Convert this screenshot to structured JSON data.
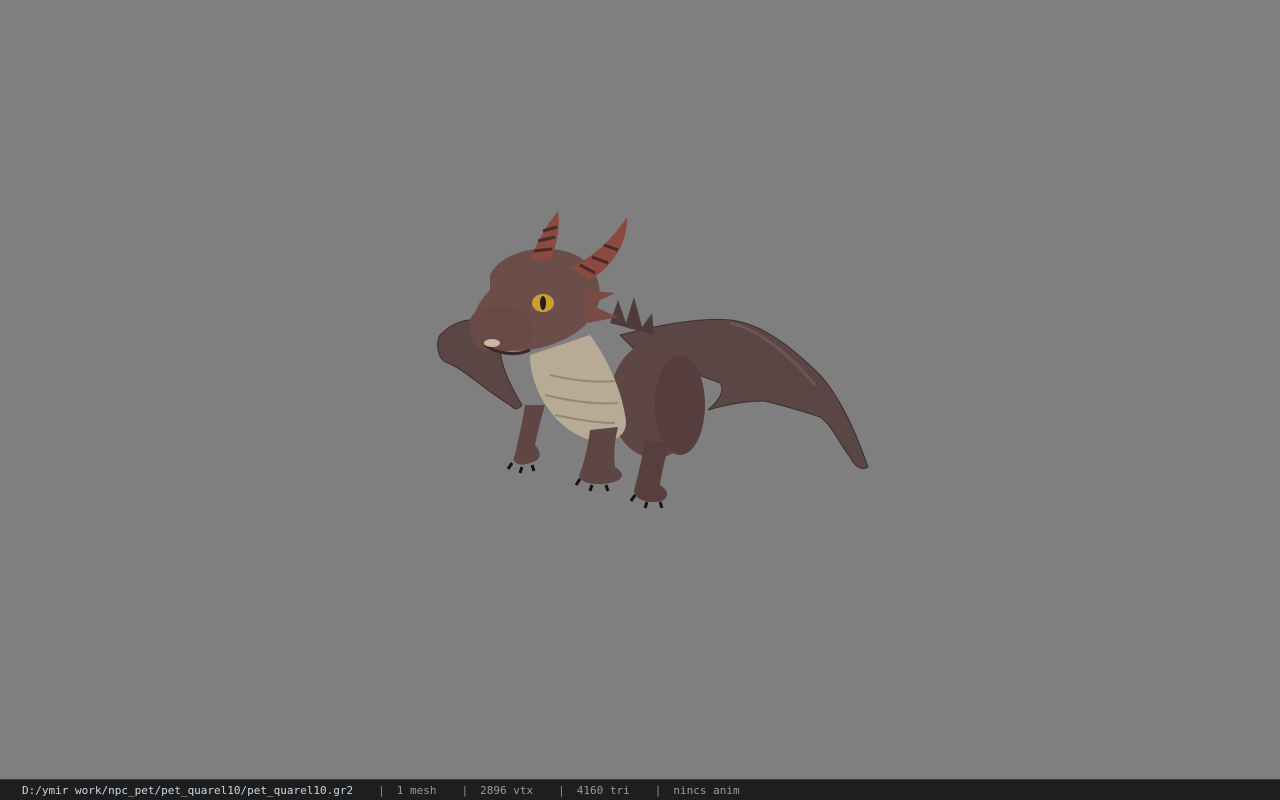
{
  "viewer": {
    "background_color": "#7f7f7f",
    "model_icon": "dragon-model-icon"
  },
  "status": {
    "file_path": "D:/ymir work/npc_pet/pet_quarel10/pet_quarel10.gr2",
    "separator": "|",
    "mesh": "1 mesh",
    "vertices": "2896 vtx",
    "triangles": "4160 tri",
    "anim": "nincs anim"
  }
}
